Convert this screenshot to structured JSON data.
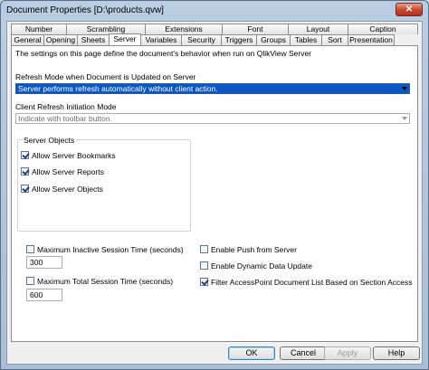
{
  "window": {
    "title": "Document Properties [D:\\products.qvw]",
    "close_glyph": "✕"
  },
  "tabs": {
    "row1": [
      "Number",
      "Scrambling",
      "Extensions",
      "Font",
      "Layout",
      "Caption"
    ],
    "row2": [
      "General",
      "Opening",
      "Sheets",
      "Server",
      "Variables",
      "Security",
      "Triggers",
      "Groups",
      "Tables",
      "Sort",
      "Presentation"
    ],
    "active": "Server"
  },
  "server_page": {
    "description": "The settings on this page define the document's behavior when run on QlikView Server",
    "refresh_mode_label": "Refresh Mode when Document is Updated on Server",
    "refresh_mode_value": "Server performs refresh automatically without client action.",
    "client_refresh_label": "Client Refresh Initiation Mode",
    "client_refresh_value": "Indicate with toolbar button.",
    "server_objects": {
      "title": "Server Objects",
      "items": [
        {
          "label": "Allow Server Bookmarks",
          "checked": true
        },
        {
          "label": "Allow Server Reports",
          "checked": true
        },
        {
          "label": "Allow Server Objects",
          "checked": true
        }
      ]
    },
    "max_inactive": {
      "label": "Maximum Inactive Session Time (seconds)",
      "checked": false,
      "value": "300"
    },
    "max_total": {
      "label": "Maximum Total Session Time (seconds)",
      "checked": false,
      "value": "600"
    },
    "enable_push": {
      "label": "Enable Push from Server",
      "checked": false
    },
    "dynamic_update": {
      "label": "Enable Dynamic Data Update",
      "checked": false
    },
    "filter_accesspoint": {
      "label": "Filter AccessPoint Document List Based on Section Access",
      "checked": true
    }
  },
  "buttons": {
    "ok": "OK",
    "cancel": "Cancel",
    "apply": "Apply",
    "help": "Help"
  }
}
